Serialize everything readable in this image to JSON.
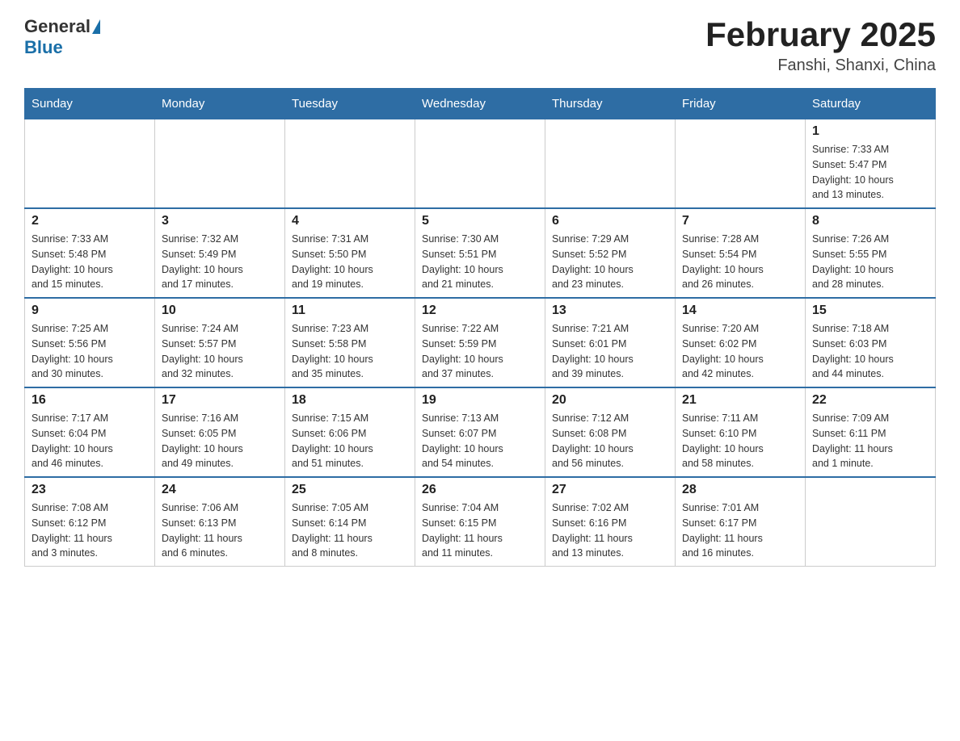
{
  "header": {
    "logo_general": "General",
    "logo_blue": "Blue",
    "month_title": "February 2025",
    "location": "Fanshi, Shanxi, China"
  },
  "weekdays": [
    "Sunday",
    "Monday",
    "Tuesday",
    "Wednesday",
    "Thursday",
    "Friday",
    "Saturday"
  ],
  "rows": [
    [
      {
        "day": "",
        "info": ""
      },
      {
        "day": "",
        "info": ""
      },
      {
        "day": "",
        "info": ""
      },
      {
        "day": "",
        "info": ""
      },
      {
        "day": "",
        "info": ""
      },
      {
        "day": "",
        "info": ""
      },
      {
        "day": "1",
        "info": "Sunrise: 7:33 AM\nSunset: 5:47 PM\nDaylight: 10 hours\nand 13 minutes."
      }
    ],
    [
      {
        "day": "2",
        "info": "Sunrise: 7:33 AM\nSunset: 5:48 PM\nDaylight: 10 hours\nand 15 minutes."
      },
      {
        "day": "3",
        "info": "Sunrise: 7:32 AM\nSunset: 5:49 PM\nDaylight: 10 hours\nand 17 minutes."
      },
      {
        "day": "4",
        "info": "Sunrise: 7:31 AM\nSunset: 5:50 PM\nDaylight: 10 hours\nand 19 minutes."
      },
      {
        "day": "5",
        "info": "Sunrise: 7:30 AM\nSunset: 5:51 PM\nDaylight: 10 hours\nand 21 minutes."
      },
      {
        "day": "6",
        "info": "Sunrise: 7:29 AM\nSunset: 5:52 PM\nDaylight: 10 hours\nand 23 minutes."
      },
      {
        "day": "7",
        "info": "Sunrise: 7:28 AM\nSunset: 5:54 PM\nDaylight: 10 hours\nand 26 minutes."
      },
      {
        "day": "8",
        "info": "Sunrise: 7:26 AM\nSunset: 5:55 PM\nDaylight: 10 hours\nand 28 minutes."
      }
    ],
    [
      {
        "day": "9",
        "info": "Sunrise: 7:25 AM\nSunset: 5:56 PM\nDaylight: 10 hours\nand 30 minutes."
      },
      {
        "day": "10",
        "info": "Sunrise: 7:24 AM\nSunset: 5:57 PM\nDaylight: 10 hours\nand 32 minutes."
      },
      {
        "day": "11",
        "info": "Sunrise: 7:23 AM\nSunset: 5:58 PM\nDaylight: 10 hours\nand 35 minutes."
      },
      {
        "day": "12",
        "info": "Sunrise: 7:22 AM\nSunset: 5:59 PM\nDaylight: 10 hours\nand 37 minutes."
      },
      {
        "day": "13",
        "info": "Sunrise: 7:21 AM\nSunset: 6:01 PM\nDaylight: 10 hours\nand 39 minutes."
      },
      {
        "day": "14",
        "info": "Sunrise: 7:20 AM\nSunset: 6:02 PM\nDaylight: 10 hours\nand 42 minutes."
      },
      {
        "day": "15",
        "info": "Sunrise: 7:18 AM\nSunset: 6:03 PM\nDaylight: 10 hours\nand 44 minutes."
      }
    ],
    [
      {
        "day": "16",
        "info": "Sunrise: 7:17 AM\nSunset: 6:04 PM\nDaylight: 10 hours\nand 46 minutes."
      },
      {
        "day": "17",
        "info": "Sunrise: 7:16 AM\nSunset: 6:05 PM\nDaylight: 10 hours\nand 49 minutes."
      },
      {
        "day": "18",
        "info": "Sunrise: 7:15 AM\nSunset: 6:06 PM\nDaylight: 10 hours\nand 51 minutes."
      },
      {
        "day": "19",
        "info": "Sunrise: 7:13 AM\nSunset: 6:07 PM\nDaylight: 10 hours\nand 54 minutes."
      },
      {
        "day": "20",
        "info": "Sunrise: 7:12 AM\nSunset: 6:08 PM\nDaylight: 10 hours\nand 56 minutes."
      },
      {
        "day": "21",
        "info": "Sunrise: 7:11 AM\nSunset: 6:10 PM\nDaylight: 10 hours\nand 58 minutes."
      },
      {
        "day": "22",
        "info": "Sunrise: 7:09 AM\nSunset: 6:11 PM\nDaylight: 11 hours\nand 1 minute."
      }
    ],
    [
      {
        "day": "23",
        "info": "Sunrise: 7:08 AM\nSunset: 6:12 PM\nDaylight: 11 hours\nand 3 minutes."
      },
      {
        "day": "24",
        "info": "Sunrise: 7:06 AM\nSunset: 6:13 PM\nDaylight: 11 hours\nand 6 minutes."
      },
      {
        "day": "25",
        "info": "Sunrise: 7:05 AM\nSunset: 6:14 PM\nDaylight: 11 hours\nand 8 minutes."
      },
      {
        "day": "26",
        "info": "Sunrise: 7:04 AM\nSunset: 6:15 PM\nDaylight: 11 hours\nand 11 minutes."
      },
      {
        "day": "27",
        "info": "Sunrise: 7:02 AM\nSunset: 6:16 PM\nDaylight: 11 hours\nand 13 minutes."
      },
      {
        "day": "28",
        "info": "Sunrise: 7:01 AM\nSunset: 6:17 PM\nDaylight: 11 hours\nand 16 minutes."
      },
      {
        "day": "",
        "info": ""
      }
    ]
  ]
}
